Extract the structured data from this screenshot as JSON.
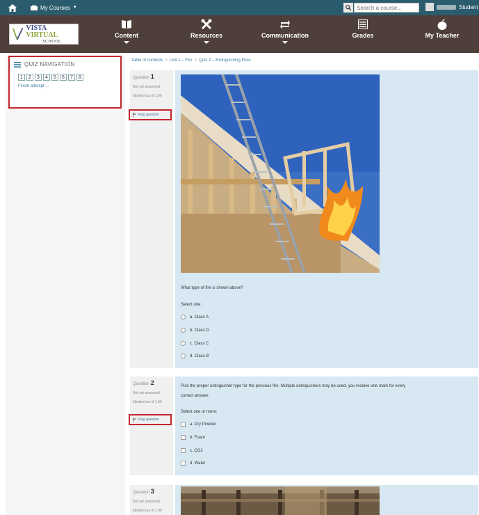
{
  "topbar": {
    "my_courses_label": "My Courses",
    "search_placeholder": "Search a course...",
    "user_label": "Student"
  },
  "navbar": {
    "logo_line1_a": "VISTA",
    "logo_line1_b": "VIRTUAL",
    "logo_line2": "SCHOOL",
    "items": [
      {
        "label": "Content",
        "icon": "book-icon"
      },
      {
        "label": "Resources",
        "icon": "tools-icon"
      },
      {
        "label": "Communication",
        "icon": "arrows-exchange-icon"
      },
      {
        "label": "Grades",
        "icon": "grades-icon"
      },
      {
        "label": "My Teacher",
        "icon": "apple-icon"
      }
    ]
  },
  "quiz_navigation": {
    "title": "QUIZ NAVIGATION",
    "buttons": [
      "1",
      "2",
      "3",
      "4",
      "5",
      "6",
      "7",
      "8"
    ],
    "finish_label": "Finish attempt ..."
  },
  "breadcrumb": {
    "items": [
      "Table of contents",
      "Unit 1 – Fire",
      "Quiz 2 – Extinguishing Fires"
    ]
  },
  "questions": [
    {
      "label": "Question",
      "number": "1",
      "status": "Not yet answered",
      "marks": "Marked out of 1.00",
      "flag_label": "Flag question",
      "prompt": "What type of fire is shown above?",
      "select_label": "Select one:",
      "options": [
        "a. Class A",
        "b. Class D",
        "c. Class C",
        "d. Class B"
      ]
    },
    {
      "label": "Question",
      "number": "2",
      "status": "Not yet answered",
      "marks": "Marked out of 1.00",
      "flag_label": "Flag question",
      "prompt_line1": "Pick the proper extinguisher type for the previous fire. Multiple extinguishers may be used, you receive one mark for every",
      "prompt_line2": "correct answer.",
      "select_label": "Select one or more:",
      "options": [
        "a. Dry Powder",
        "b. Foam",
        "c. CO2",
        "d. Water"
      ]
    },
    {
      "label": "Question",
      "number": "3",
      "status": "Not yet answered",
      "marks": "Marked out of 1.00"
    }
  ],
  "colors": {
    "topbar": "#2b5c6d",
    "navbar": "#4f3f3a",
    "question_bg": "#d8e8f2",
    "highlight": "#c4262e",
    "link": "#3a7b9f"
  }
}
